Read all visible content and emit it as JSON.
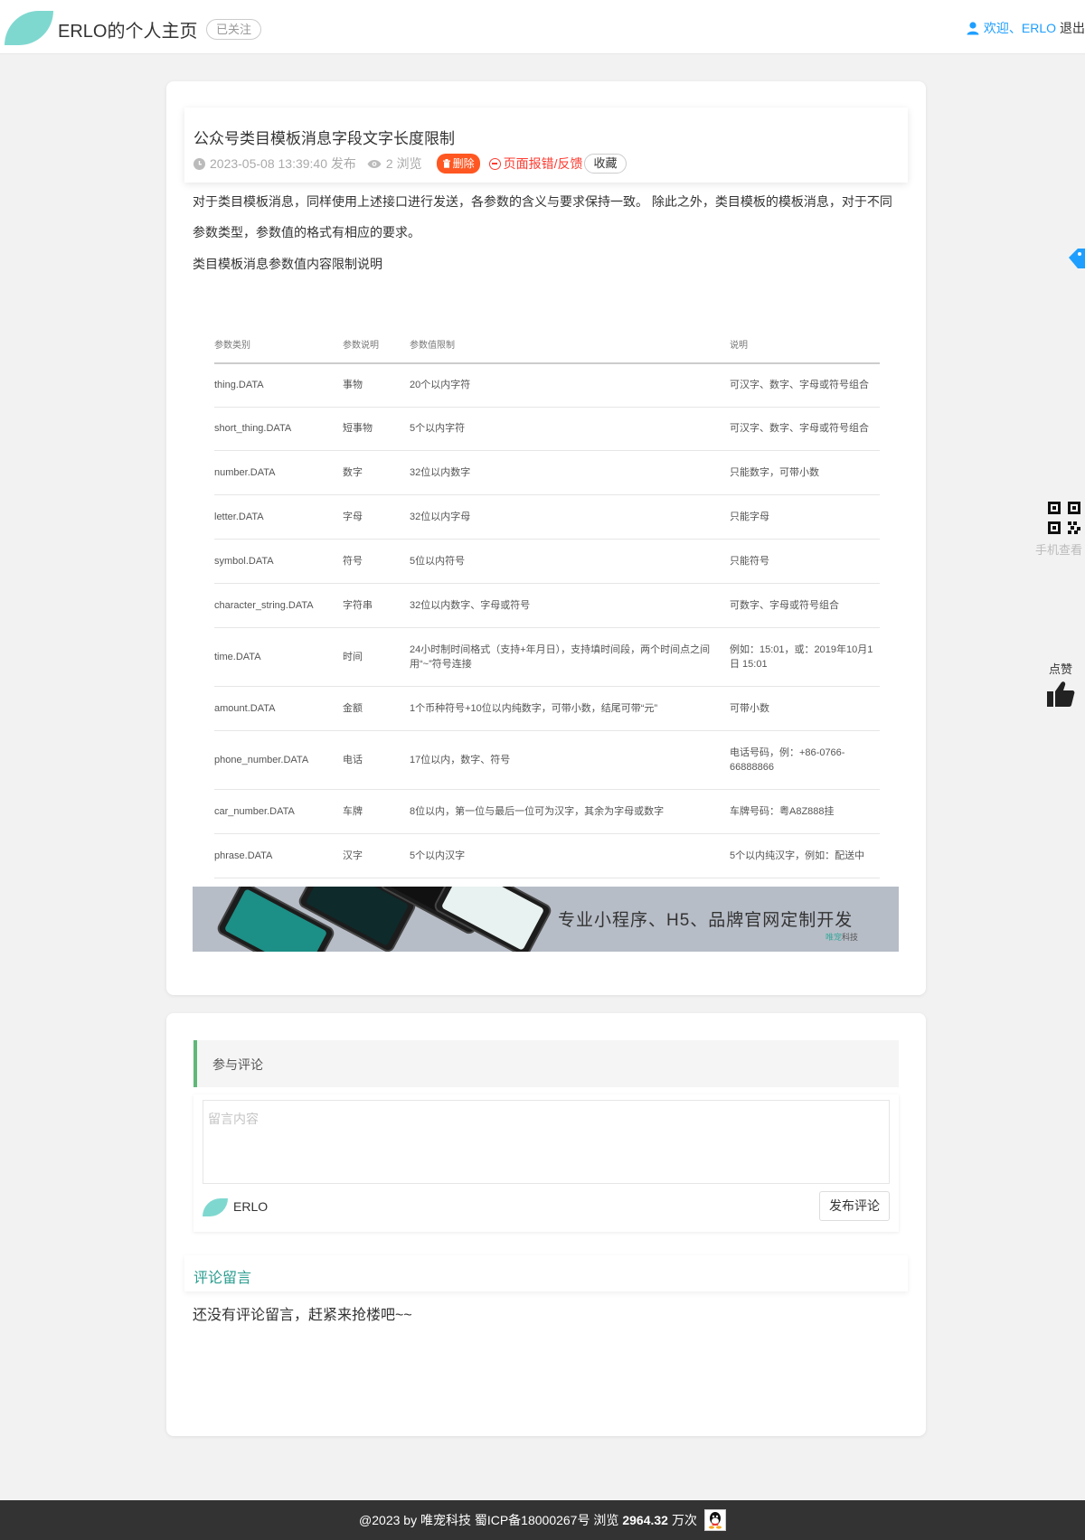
{
  "header": {
    "site_title": "ERLO的个人主页",
    "follow_badge": "已关注",
    "welcome": "欢迎、ERLO",
    "logout": "退出"
  },
  "article": {
    "title": "公众号类目模板消息字段文字长度限制",
    "publish": "2023-05-08 13:39:40 发布",
    "views": "2 浏览",
    "delete_label": "删除",
    "report_label": "页面报错/反馈",
    "collect_label": "收藏",
    "para1": "对于类目模板消息，同样使用上述接口进行发送，各参数的含义与要求保持一致。 除此之外，类目模板的模板消息，对于不同",
    "para2": "参数类型，参数值的格式有相应的要求。",
    "para3": "类目模板消息参数值内容限制说明"
  },
  "table": {
    "headers": [
      "参数类别",
      "参数说明",
      "参数值限制",
      "说明"
    ],
    "rows": [
      [
        "thing.DATA",
        "事物",
        "20个以内字符",
        "可汉字、数字、字母或符号组合"
      ],
      [
        "short_thing.DATA",
        "短事物",
        "5个以内字符",
        "可汉字、数字、字母或符号组合"
      ],
      [
        "number.DATA",
        "数字",
        "32位以内数字",
        "只能数字，可带小数"
      ],
      [
        "letter.DATA",
        "字母",
        "32位以内字母",
        "只能字母"
      ],
      [
        "symbol.DATA",
        "符号",
        "5位以内符号",
        "只能符号"
      ],
      [
        "character_string.DATA",
        "字符串",
        "32位以内数字、字母或符号",
        "可数字、字母或符号组合"
      ],
      [
        "time.DATA",
        "时间",
        "24小时制时间格式（支持+年月日），支持填时间段，两个时间点之间用“~”符号连接",
        "例如：15:01，或：2019年10月1日 15:01"
      ],
      [
        "amount.DATA",
        "金额",
        "1个币种符号+10位以内纯数字，可带小数，结尾可带“元”",
        "可带小数"
      ],
      [
        "phone_number.DATA",
        "电话",
        "17位以内，数字、符号",
        "电话号码，例：+86-0766-66888866"
      ],
      [
        "car_number.DATA",
        "车牌",
        "8位以内，第一位与最后一位可为汉字，其余为字母或数字",
        "车牌号码：粤A8Z888挂"
      ],
      [
        "phrase.DATA",
        "汉字",
        "5个以内汉字",
        "5个以内纯汉字，例如：配送中"
      ]
    ]
  },
  "banner": {
    "text": "专业小程序、H5、品牌官网定制开发",
    "sub_highlight": "唯宠",
    "sub_rest": "科技"
  },
  "comment": {
    "section_title": "参与评论",
    "placeholder": "留言内容",
    "username": "ERLO",
    "submit_label": "发布评论",
    "list_title": "评论留言",
    "empty_text": "还没有评论留言，赶紧来抢楼吧~~"
  },
  "side": {
    "qr_label": "手机查看",
    "like_label": "点赞"
  },
  "footer": {
    "prefix": "@2023 by 唯宠科技 蜀ICP备18000267号 浏览",
    "views": "2964.32",
    "suffix": "万次"
  },
  "colors": {
    "accent_green": "#5fb878",
    "leaf": "#7fd8d0",
    "link_blue": "#1e9fff",
    "danger": "#ff5722",
    "footer_bg": "#333333"
  }
}
